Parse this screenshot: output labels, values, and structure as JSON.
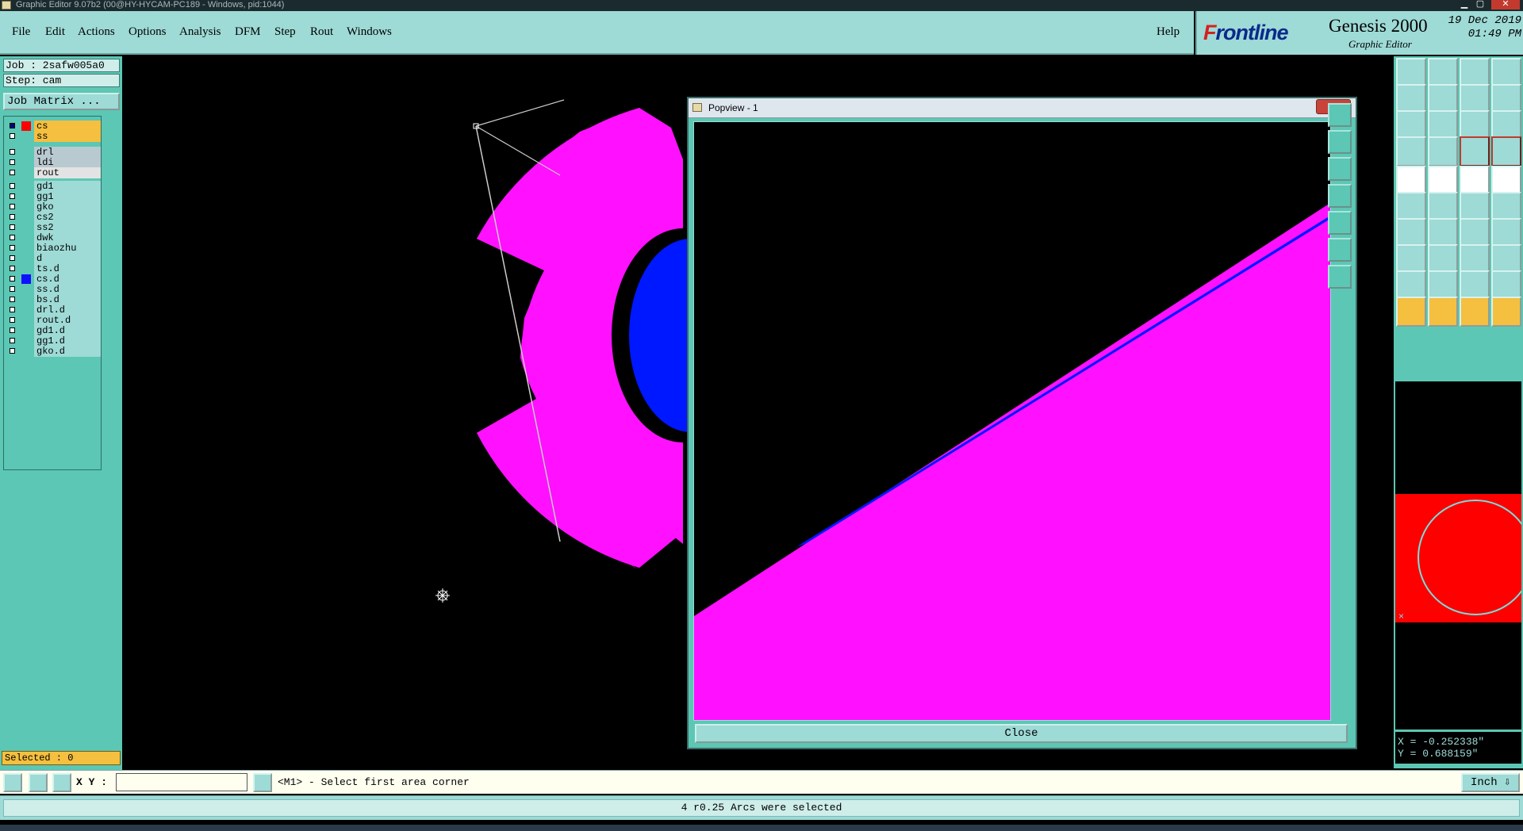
{
  "window": {
    "title": "Graphic Editor 9.07b2 (00@HY-HYCAM-PC189 - Windows, pid:1044)"
  },
  "menu": {
    "items": [
      "File",
      "Edit",
      "Actions",
      "Options",
      "Analysis",
      "DFM",
      "Step",
      "Rout",
      "Windows"
    ],
    "help": "Help"
  },
  "brand": {
    "logo_a": "F",
    "logo_b": "rontline",
    "product": "Genesis 2000",
    "subtitle": "Graphic Editor",
    "date": "19 Dec 2019",
    "time": "01:49 PM"
  },
  "job": {
    "job_label": "Job : 2safw005a0",
    "step_label": "Step: cam",
    "matrix_button": "Job Matrix ..."
  },
  "layers": [
    {
      "name": "cs",
      "color": "#f5bf3f",
      "swatch": "#ff0000",
      "checked": true,
      "mark": "✐▪"
    },
    {
      "name": "ss",
      "color": "#f5bf3f",
      "swatch": "",
      "checked": false,
      "mark": "✐"
    },
    {
      "name": "drl",
      "color": "#b9c9d0",
      "swatch": "",
      "checked": false,
      "mark": ""
    },
    {
      "name": "ldi",
      "color": "#b9c9d0",
      "swatch": "",
      "checked": false,
      "mark": ""
    },
    {
      "name": "rout",
      "color": "#e3e3e3",
      "swatch": "",
      "checked": false,
      "mark": ""
    },
    {
      "name": "gd1",
      "color": "#9edad6",
      "swatch": "",
      "checked": false,
      "mark": ""
    },
    {
      "name": "gg1",
      "color": "#9edad6",
      "swatch": "",
      "checked": false,
      "mark": ""
    },
    {
      "name": "gko",
      "color": "#9edad6",
      "swatch": "",
      "checked": false,
      "mark": "✐"
    },
    {
      "name": "cs2",
      "color": "#9edad6",
      "swatch": "",
      "checked": false,
      "mark": ""
    },
    {
      "name": "ss2",
      "color": "#9edad6",
      "swatch": "",
      "checked": false,
      "mark": ""
    },
    {
      "name": "dwk",
      "color": "#9edad6",
      "swatch": "",
      "checked": false,
      "mark": ""
    },
    {
      "name": "biaozhu",
      "color": "#9edad6",
      "swatch": "",
      "checked": false,
      "mark": ""
    },
    {
      "name": "d",
      "color": "#9edad6",
      "swatch": "",
      "checked": false,
      "mark": ""
    },
    {
      "name": "ts.d",
      "color": "#9edad6",
      "swatch": "",
      "checked": false,
      "mark": ""
    },
    {
      "name": "cs.d",
      "color": "#9edad6",
      "swatch": "#1010ff",
      "checked": false,
      "mark": "✐"
    },
    {
      "name": "ss.d",
      "color": "#9edad6",
      "swatch": "",
      "checked": false,
      "mark": "✐"
    },
    {
      "name": "bs.d",
      "color": "#9edad6",
      "swatch": "",
      "checked": false,
      "mark": ""
    },
    {
      "name": "drl.d",
      "color": "#9edad6",
      "swatch": "",
      "checked": false,
      "mark": ""
    },
    {
      "name": "rout.d",
      "color": "#9edad6",
      "swatch": "",
      "checked": false,
      "mark": ""
    },
    {
      "name": "gd1.d",
      "color": "#9edad6",
      "swatch": "",
      "checked": false,
      "mark": ""
    },
    {
      "name": "gg1.d",
      "color": "#9edad6",
      "swatch": "",
      "checked": false,
      "mark": ""
    },
    {
      "name": "gko.d",
      "color": "#9edad6",
      "swatch": "",
      "checked": false,
      "mark": "✐"
    }
  ],
  "selected": {
    "label": "Selected : 0"
  },
  "popview": {
    "title": "Popview - 1",
    "close_x": "✕",
    "close_button": "Close"
  },
  "coords": {
    "x": "X = -0.252338\"",
    "y": "Y = 0.688159\""
  },
  "cmdbar": {
    "xy_label": "X Y :",
    "xy_value": "",
    "prompt": "<M1> - Select first area corner",
    "units": "Inch"
  },
  "status": {
    "message": "4 r0.25 Arcs were selected"
  },
  "colors": {
    "feature_magenta": "#ff10ff",
    "feature_blue": "#0018ff",
    "panel": "#5cc7b4",
    "menu": "#9edad6"
  }
}
